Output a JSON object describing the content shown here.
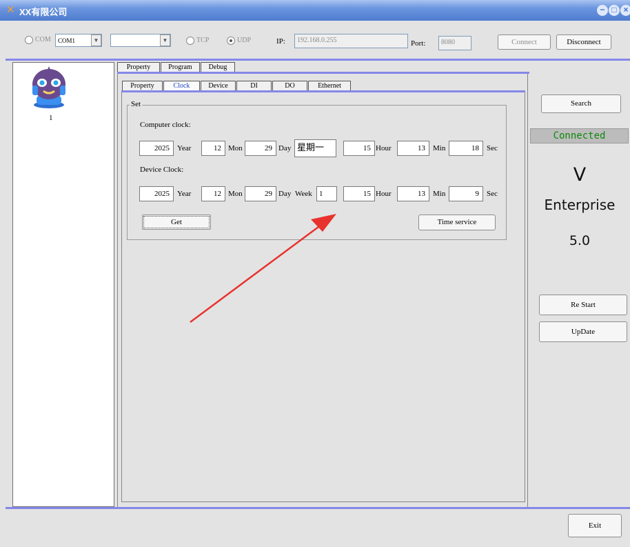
{
  "window": {
    "title": "XX有限公司",
    "icon": "tools-icon",
    "controls": [
      "−",
      "□",
      "×"
    ]
  },
  "toolbar": {
    "com_label": "COM",
    "com_port_value": "COM1",
    "second_select_value": "",
    "tcp_label": "TCP",
    "udp_label": "UDP",
    "ip_label": "IP:",
    "ip_value": "192.168.0.255",
    "port_label": "Port:",
    "port_value": "8080",
    "connect_label": "Connect",
    "disconnect_label": "Disconnect",
    "selected_protocol": "UDP"
  },
  "device_list": {
    "items": [
      {
        "label": "1",
        "icon": "robot-icon"
      }
    ]
  },
  "tabs_outer": [
    "Property",
    "Program",
    "Debug"
  ],
  "tabs_inner": [
    "Property",
    "Clock",
    "Device",
    "DI",
    "DO",
    "Ethernet"
  ],
  "active_inner_tab": "Clock",
  "set_group": {
    "legend": "Set",
    "computer_label": "Computer clock:",
    "computer": {
      "year": "2025",
      "year_unit": "Year",
      "mon": "12",
      "mon_unit": "Mon",
      "day": "29",
      "day_unit": "Day",
      "weekday": "星期一",
      "hour": "15",
      "hour_unit": "Hour",
      "min": "13",
      "min_unit": "Min",
      "sec": "18",
      "sec_unit": "Sec"
    },
    "device_label": "Device Clock:",
    "device": {
      "year": "2025",
      "year_unit": "Year",
      "mon": "12",
      "mon_unit": "Mon",
      "day": "29",
      "day_unit": "Day",
      "week_label": "Week",
      "week": "1",
      "hour": "15",
      "hour_unit": "Hour",
      "min": "13",
      "min_unit": "Min",
      "sec": "9",
      "sec_unit": "Sec"
    },
    "get_label": "Get",
    "time_service_label": "Time service"
  },
  "right_panel": {
    "search_label": "Search",
    "status": "Connected",
    "version_letter": "V",
    "edition": "Enterprise",
    "version": "5.0",
    "restart_label": "Re Start",
    "update_label": "UpDate"
  },
  "footer": {
    "exit_label": "Exit"
  },
  "colors": {
    "accent_line": "#8488e8",
    "status_text": "#0a8a0a",
    "arrow": "#e8322d",
    "active_tab": "#1a46c4"
  }
}
